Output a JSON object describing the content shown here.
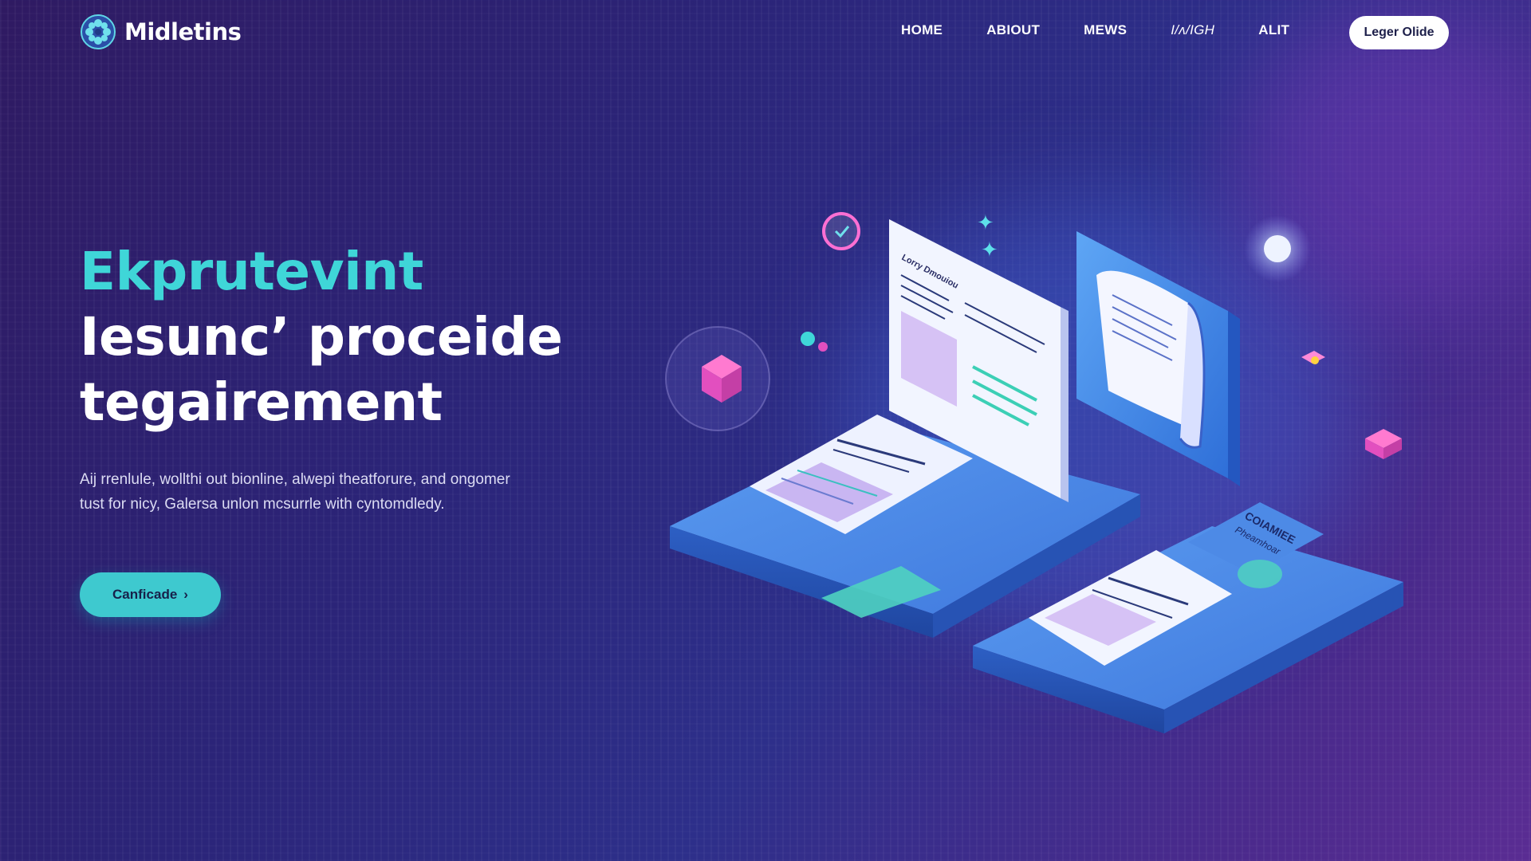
{
  "brand": {
    "name": "Midletins",
    "logo_icon": "flower-icon"
  },
  "nav": {
    "items": [
      {
        "label": "HOME"
      },
      {
        "label": "ABIOUT"
      },
      {
        "label": "MEWS"
      },
      {
        "label": "I/ᴧ/IGH"
      },
      {
        "label": "ALIT"
      }
    ],
    "cta_label": "Leger Olide"
  },
  "hero": {
    "headline_accent": "Ekprutevint",
    "headline_line2": "Iesunc’ proceide",
    "headline_line3": "tegairement",
    "body": "Aij rrenlule, wollthi out bionline, alwepi theatforure, and ongomer tust for nicy, Galersa unlon mcsurrle with cyntomdledy.",
    "button_label": "Canficade",
    "button_icon": "chevron-right-icon"
  },
  "illustration": {
    "doc_heading": "Lorry Dmouiou",
    "badge_line1": "COIAMIEE",
    "badge_line2": "Pheamhoar"
  },
  "colors": {
    "accent": "#3fd6d8",
    "button": "#3ec9cf",
    "platform": "#3d7fe0",
    "pink": "#e24fbf"
  }
}
